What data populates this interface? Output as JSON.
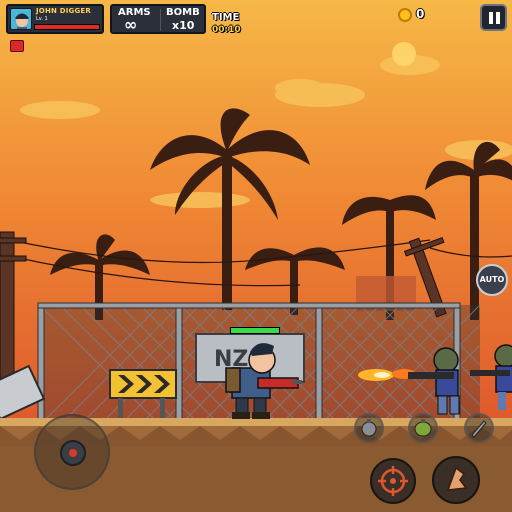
{
  "hud": {
    "player": {
      "name": "JOHN DIGGER",
      "level": "Lv. 1",
      "hp_fraction": 1.0
    },
    "weapons": {
      "arms_label": "ARMS",
      "arms_value": "∞",
      "bomb_label": "BOMB",
      "bomb_value": "x10"
    },
    "time": {
      "label": "TIME",
      "value": "00:10"
    },
    "coins": {
      "value": "0"
    }
  },
  "controls": {
    "auto_label": "AUTO"
  },
  "scene": {
    "sign_text": "NZ"
  },
  "ally": {
    "hp_fraction": 1.0
  },
  "colors": {
    "sky_top": "#f3a13a",
    "sky_bottom": "#e55f2c",
    "sun": "#ffd66b",
    "ground": "#a06a3a",
    "palm": "#3a1e12",
    "accent_gold": "#ffd24a",
    "hp_red": "#e02a24",
    "hp_green": "#3ad94a"
  },
  "icons": [
    "portrait-icon",
    "infinity-icon",
    "coin-icon",
    "pause-icon",
    "buff-icon",
    "grenade-icon",
    "knife-icon",
    "crosshair-icon",
    "jump-icon"
  ]
}
